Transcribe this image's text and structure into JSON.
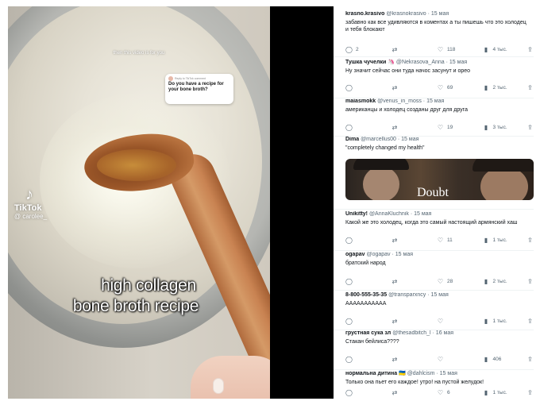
{
  "video": {
    "caption_top": "then this video is for you",
    "reply_label": "Reply to TikTok comment",
    "reply_text": "Do you have a recipe for your bone broth?",
    "tiktok_word": "TikTok",
    "tiktok_handle": "@ carolee_",
    "caption_line1": "high collagen",
    "caption_line2": "bone broth recipe"
  },
  "icons": {
    "reply": "reply-icon",
    "retweet": "retweet-icon",
    "like": "heart-icon",
    "views": "views-icon",
    "share": "share-icon"
  },
  "tweets": [
    {
      "name": "krasno.krasivo",
      "handle": "@krasnokrasivo",
      "date": "· 15 мая",
      "text": "забавно как все удивляются в коментах а ты пишешь что это холодец и тебя блокают",
      "replies": "2",
      "retweets": "",
      "likes": "118",
      "views": "4 тыс."
    },
    {
      "name": "Тушка чучелки 🦄",
      "handle": "@Nekrasova_Anna",
      "date": "· 15 мая",
      "text": "Ну значит сейчас они туда начос засунут и орео",
      "replies": "",
      "retweets": "",
      "likes": "69",
      "views": "2 тыс."
    },
    {
      "name": "maiasmokk",
      "handle": "@venus_in_moss",
      "date": "· 15 мая",
      "text": "американцы и холодец созданы друг для друга",
      "replies": "",
      "retweets": "",
      "likes": "19",
      "views": "3 тыс."
    },
    {
      "name": "Dima",
      "handle": "@marcellus00",
      "date": "· 15 мая",
      "text": "\"completely changed my health\"",
      "media_text": "Doubt"
    },
    {
      "name": "Unikitty!",
      "handle": "@AnnaKluchnik",
      "date": "· 15 мая",
      "text": "Какой же это холодец, когда это самый настоящий армянский хаш",
      "replies": "",
      "retweets": "",
      "likes": "11",
      "views": "1 тыс."
    },
    {
      "name": "ogapav",
      "handle": "@ogapav",
      "date": "· 15 мая",
      "text": "братский народ",
      "replies": "",
      "retweets": "",
      "likes": "28",
      "views": "2 тыс."
    },
    {
      "name": "8-800-555-35-35",
      "handle": "@transparxncy",
      "date": "· 15 мая",
      "text": "ААААААААААА",
      "replies": "",
      "retweets": "",
      "likes": "",
      "views": "1 тыс."
    },
    {
      "name": "грустная сука зл",
      "handle": "@thesadbitch_l",
      "date": "· 16 мая",
      "text": "Стакан бейлиса????",
      "replies": "",
      "retweets": "",
      "likes": "",
      "views": "406"
    },
    {
      "name": "нормальна дитина 🇺🇦",
      "handle": "@dahlcism",
      "date": "· 15 мая",
      "text": "Только она пьет его каждое! утро! на пустой желудок!",
      "replies": "",
      "retweets": "",
      "likes": "6",
      "views": "1 тыс."
    }
  ]
}
